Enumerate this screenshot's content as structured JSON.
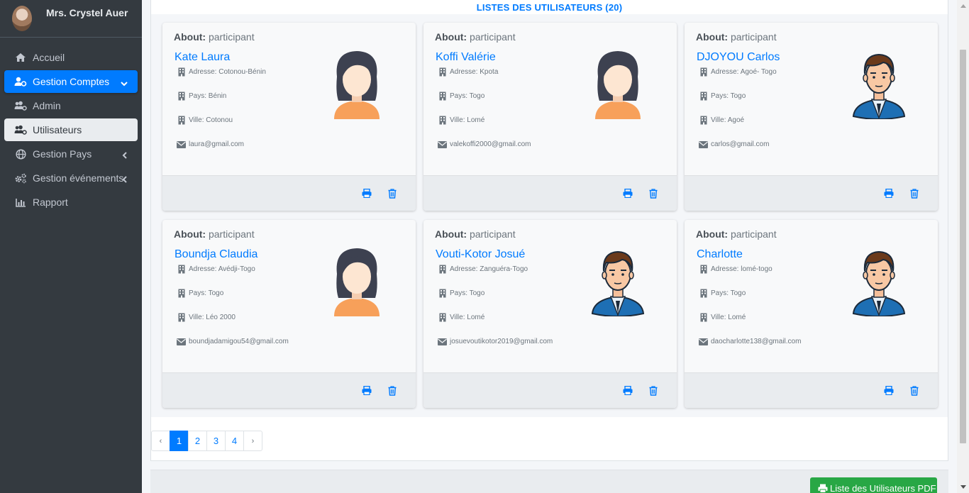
{
  "sidebar": {
    "user_name": "Mrs. Crystel Auer",
    "items": [
      {
        "label": "Accueil",
        "icon": "home-icon"
      },
      {
        "label": "Gestion Comptes",
        "icon": "user-cog-icon"
      },
      {
        "label": "Admin",
        "icon": "users-cog-icon"
      },
      {
        "label": "Utilisateurs",
        "icon": "users-cog-icon"
      },
      {
        "label": "Gestion Pays",
        "icon": "globe-icon"
      },
      {
        "label": "Gestion événements",
        "icon": "cogs-icon"
      },
      {
        "label": "Rapport",
        "icon": "chart-bar-icon"
      }
    ]
  },
  "main": {
    "title": "LISTES DES UTILISATEURS (20)",
    "about_label": "About:",
    "cards": [
      {
        "about": "participant",
        "name": "Kate Laura",
        "adresse": "Adresse: Cotonou-Bénin",
        "pays": "Pays: Bénin",
        "ville": "Ville: Cotonou",
        "email": "laura@gmail.com",
        "avatar": "female-avatar"
      },
      {
        "about": "participant",
        "name": "Koffi Valérie",
        "adresse": "Adresse: Kpota",
        "pays": "Pays: Togo",
        "ville": "Ville: Lomé",
        "email": "valekoffi2000@gmail.com",
        "avatar": "female-avatar"
      },
      {
        "about": "participant",
        "name": "DJOYOU Carlos",
        "adresse": "Adresse: Agoé- Togo",
        "pays": "Pays: Togo",
        "ville": "Ville: Agoé",
        "email": "carlos@gmail.com",
        "avatar": "male-avatar"
      },
      {
        "about": "participant",
        "name": "Boundja Claudia",
        "adresse": "Adresse: Avédji-Togo",
        "pays": "Pays: Togo",
        "ville": "Ville: Léo 2000",
        "email": "boundjadamigou54@gmail.com",
        "avatar": "female-avatar"
      },
      {
        "about": "participant",
        "name": "Vouti-Kotor Josué",
        "adresse": "Adresse: Zanguéra-Togo",
        "pays": "Pays: Togo",
        "ville": "Ville: Lomé",
        "email": "josuevoutikotor2019@gmail.com",
        "avatar": "male-avatar"
      },
      {
        "about": "participant",
        "name": "Charlotte",
        "adresse": "Adresse: lomé-togo",
        "pays": "Pays: Togo",
        "ville": "Ville: Lomé",
        "email": "daocharlotte138@gmail.com",
        "avatar": "male-avatar"
      }
    ],
    "pagination": {
      "prev": "‹",
      "pages": [
        "1",
        "2",
        "3",
        "4"
      ],
      "next": "›",
      "current": "1"
    },
    "pdf_button": "Liste des Utilisateurs PDF"
  },
  "colors": {
    "sidebar_bg": "#343a40",
    "primary": "#007bff",
    "success": "#28a745"
  }
}
